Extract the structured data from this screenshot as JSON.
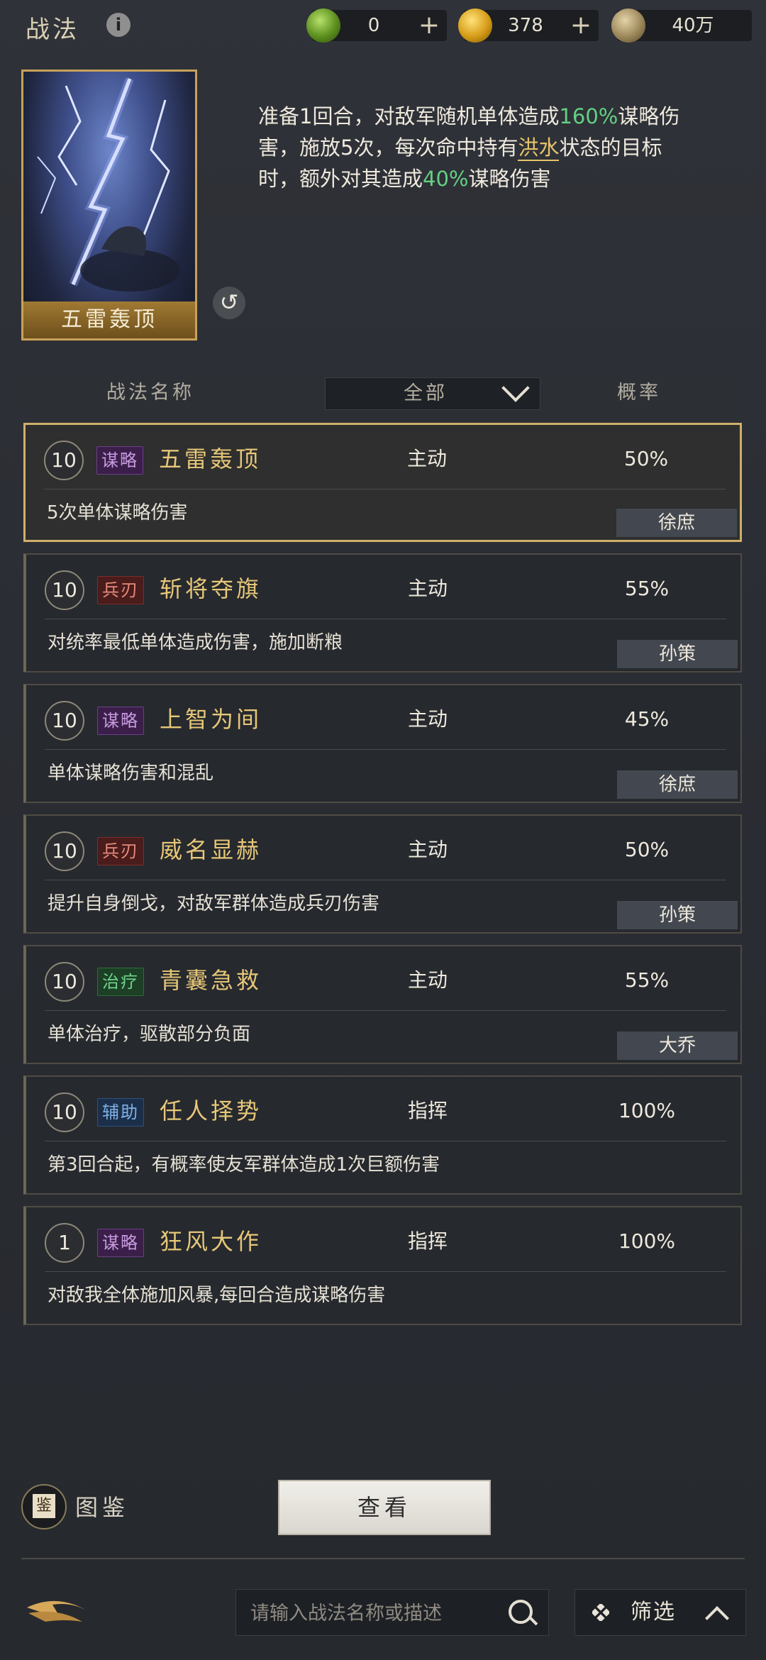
{
  "header": {
    "title": "战法",
    "resources": {
      "jade": "0",
      "gold": "378",
      "copper": "40万"
    }
  },
  "featured": {
    "card_name": "五雷轰顶",
    "desc_parts": [
      "准备1回合，对敌军随机单体造成",
      "160%",
      "谋略伤害，施放5次，每次命中持有",
      "洪水",
      "状态的目标时，额外对其造成",
      "40%",
      "谋略伤害"
    ]
  },
  "list_header": {
    "name_label": "战法名称",
    "filter_label": "全部",
    "rate_label": "概率"
  },
  "skills": [
    {
      "level": "10",
      "tag": "谋略",
      "name": "五雷轰顶",
      "type": "主动",
      "rate": "50%",
      "desc": "5次单体谋略伤害",
      "owner": "徐庶"
    },
    {
      "level": "10",
      "tag": "兵刃",
      "name": "斩将夺旗",
      "type": "主动",
      "rate": "55%",
      "desc": "对统率最低单体造成伤害，施加断粮",
      "owner": "孙策"
    },
    {
      "level": "10",
      "tag": "谋略",
      "name": "上智为间",
      "type": "主动",
      "rate": "45%",
      "desc": "单体谋略伤害和混乱",
      "owner": "徐庶"
    },
    {
      "level": "10",
      "tag": "兵刃",
      "name": "威名显赫",
      "type": "主动",
      "rate": "50%",
      "desc": "提升自身倒戈，对敌军群体造成兵刃伤害",
      "owner": "孙策"
    },
    {
      "level": "10",
      "tag": "治疗",
      "name": "青囊急救",
      "type": "主动",
      "rate": "55%",
      "desc": "单体治疗，驱散部分负面",
      "owner": "大乔"
    },
    {
      "level": "10",
      "tag": "辅助",
      "name": "任人择势",
      "type": "指挥",
      "rate": "100%",
      "desc": "第3回合起，有概率使友军群体造成1次巨额伤害",
      "owner": ""
    },
    {
      "level": "1",
      "tag": "谋略",
      "name": "狂风大作",
      "type": "指挥",
      "rate": "100%",
      "desc": "对敌我全体施加风暴,每回合造成谋略伤害",
      "owner": ""
    }
  ],
  "footer": {
    "codex_label": "图鉴",
    "codex_icon_char": "鉴",
    "view_button": "查看",
    "search_placeholder": "请输入战法名称或描述",
    "filter_label": "筛选"
  }
}
